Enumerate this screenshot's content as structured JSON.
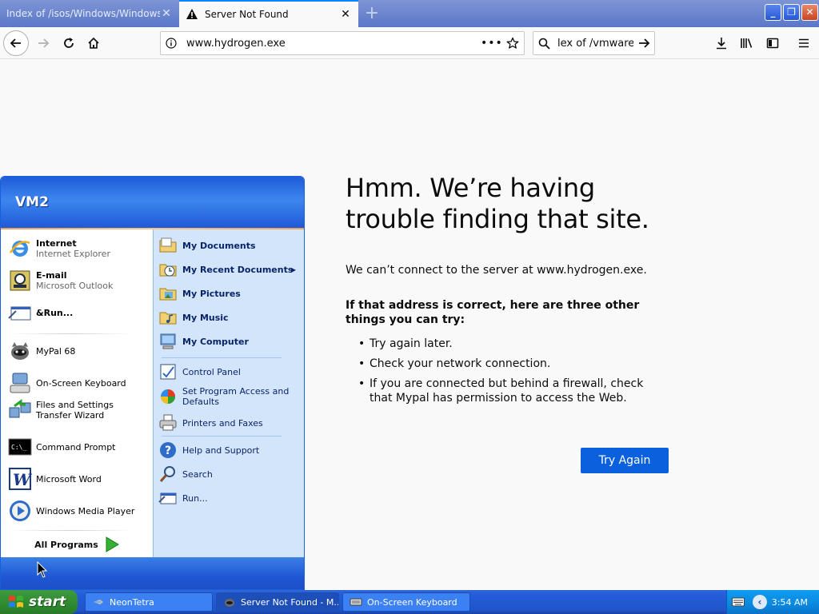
{
  "browser": {
    "tabs": [
      {
        "title": "Index of /isos/Windows/Windows_Vist",
        "active": false
      },
      {
        "title": "Server Not Found",
        "active": true
      }
    ],
    "url": "www.hydrogen.exe",
    "search_text": "lex of /vmware/",
    "window_controls": {
      "minimize": "_",
      "restore": "❐",
      "close": "✕"
    }
  },
  "error_page": {
    "title": "Hmm. We’re having trouble finding that site.",
    "description": "We can’t connect to the server at www.hydrogen.exe.",
    "subtitle": "If that address is correct, here are three other things you can try:",
    "suggestions": [
      "Try again later.",
      "Check your network connection.",
      "If you are connected but behind a firewall, check that Mypal has permission to access the Web."
    ],
    "button_label": "Try Again"
  },
  "start_menu": {
    "user": "VM2",
    "pinned": [
      {
        "title": "Internet",
        "subtitle": "Internet Explorer",
        "icon": "ie-icon"
      },
      {
        "title": "E-mail",
        "subtitle": "Microsoft Outlook",
        "icon": "outlook-icon"
      },
      {
        "title": "&Run...",
        "subtitle": "",
        "icon": "run-icon"
      }
    ],
    "recent": [
      {
        "title": "MyPal 68",
        "icon": "mypal-icon"
      },
      {
        "title": "On-Screen Keyboard",
        "icon": "keyboard-icon"
      },
      {
        "title": "Files and Settings Transfer Wizard",
        "icon": "transfer-icon"
      },
      {
        "title": "Command Prompt",
        "icon": "cmd-icon"
      },
      {
        "title": "Microsoft Word",
        "icon": "word-icon"
      },
      {
        "title": "Windows Media Player",
        "icon": "wmp-icon"
      }
    ],
    "all_programs": "All Programs",
    "right_bold": [
      {
        "label": "My Documents",
        "icon": "folder-icon"
      },
      {
        "label": "My Recent Documents",
        "icon": "recent-docs-icon"
      },
      {
        "label": "My Pictures",
        "icon": "pictures-icon"
      },
      {
        "label": "My Music",
        "icon": "music-icon"
      },
      {
        "label": "My Computer",
        "icon": "computer-icon"
      }
    ],
    "right_settings": [
      {
        "label": "Control Panel",
        "icon": "control-panel-icon"
      },
      {
        "label": "Set Program Access and Defaults",
        "icon": "defaults-icon"
      },
      {
        "label": "Printers and Faxes",
        "icon": "printer-icon"
      }
    ],
    "right_help": [
      {
        "label": "Help and Support",
        "icon": "help-icon"
      },
      {
        "label": "Search",
        "icon": "search-icon"
      },
      {
        "label": "Run...",
        "icon": "run-icon"
      }
    ]
  },
  "taskbar": {
    "start_label": "start",
    "tasks": [
      {
        "label": "NeonTetra",
        "icon": "neontetra-icon"
      },
      {
        "label": "Server Not Found - M...",
        "icon": "mypal-icon"
      },
      {
        "label": "On-Screen Keyboard",
        "icon": "keyboard-icon"
      }
    ],
    "clock": "3:54 AM"
  }
}
